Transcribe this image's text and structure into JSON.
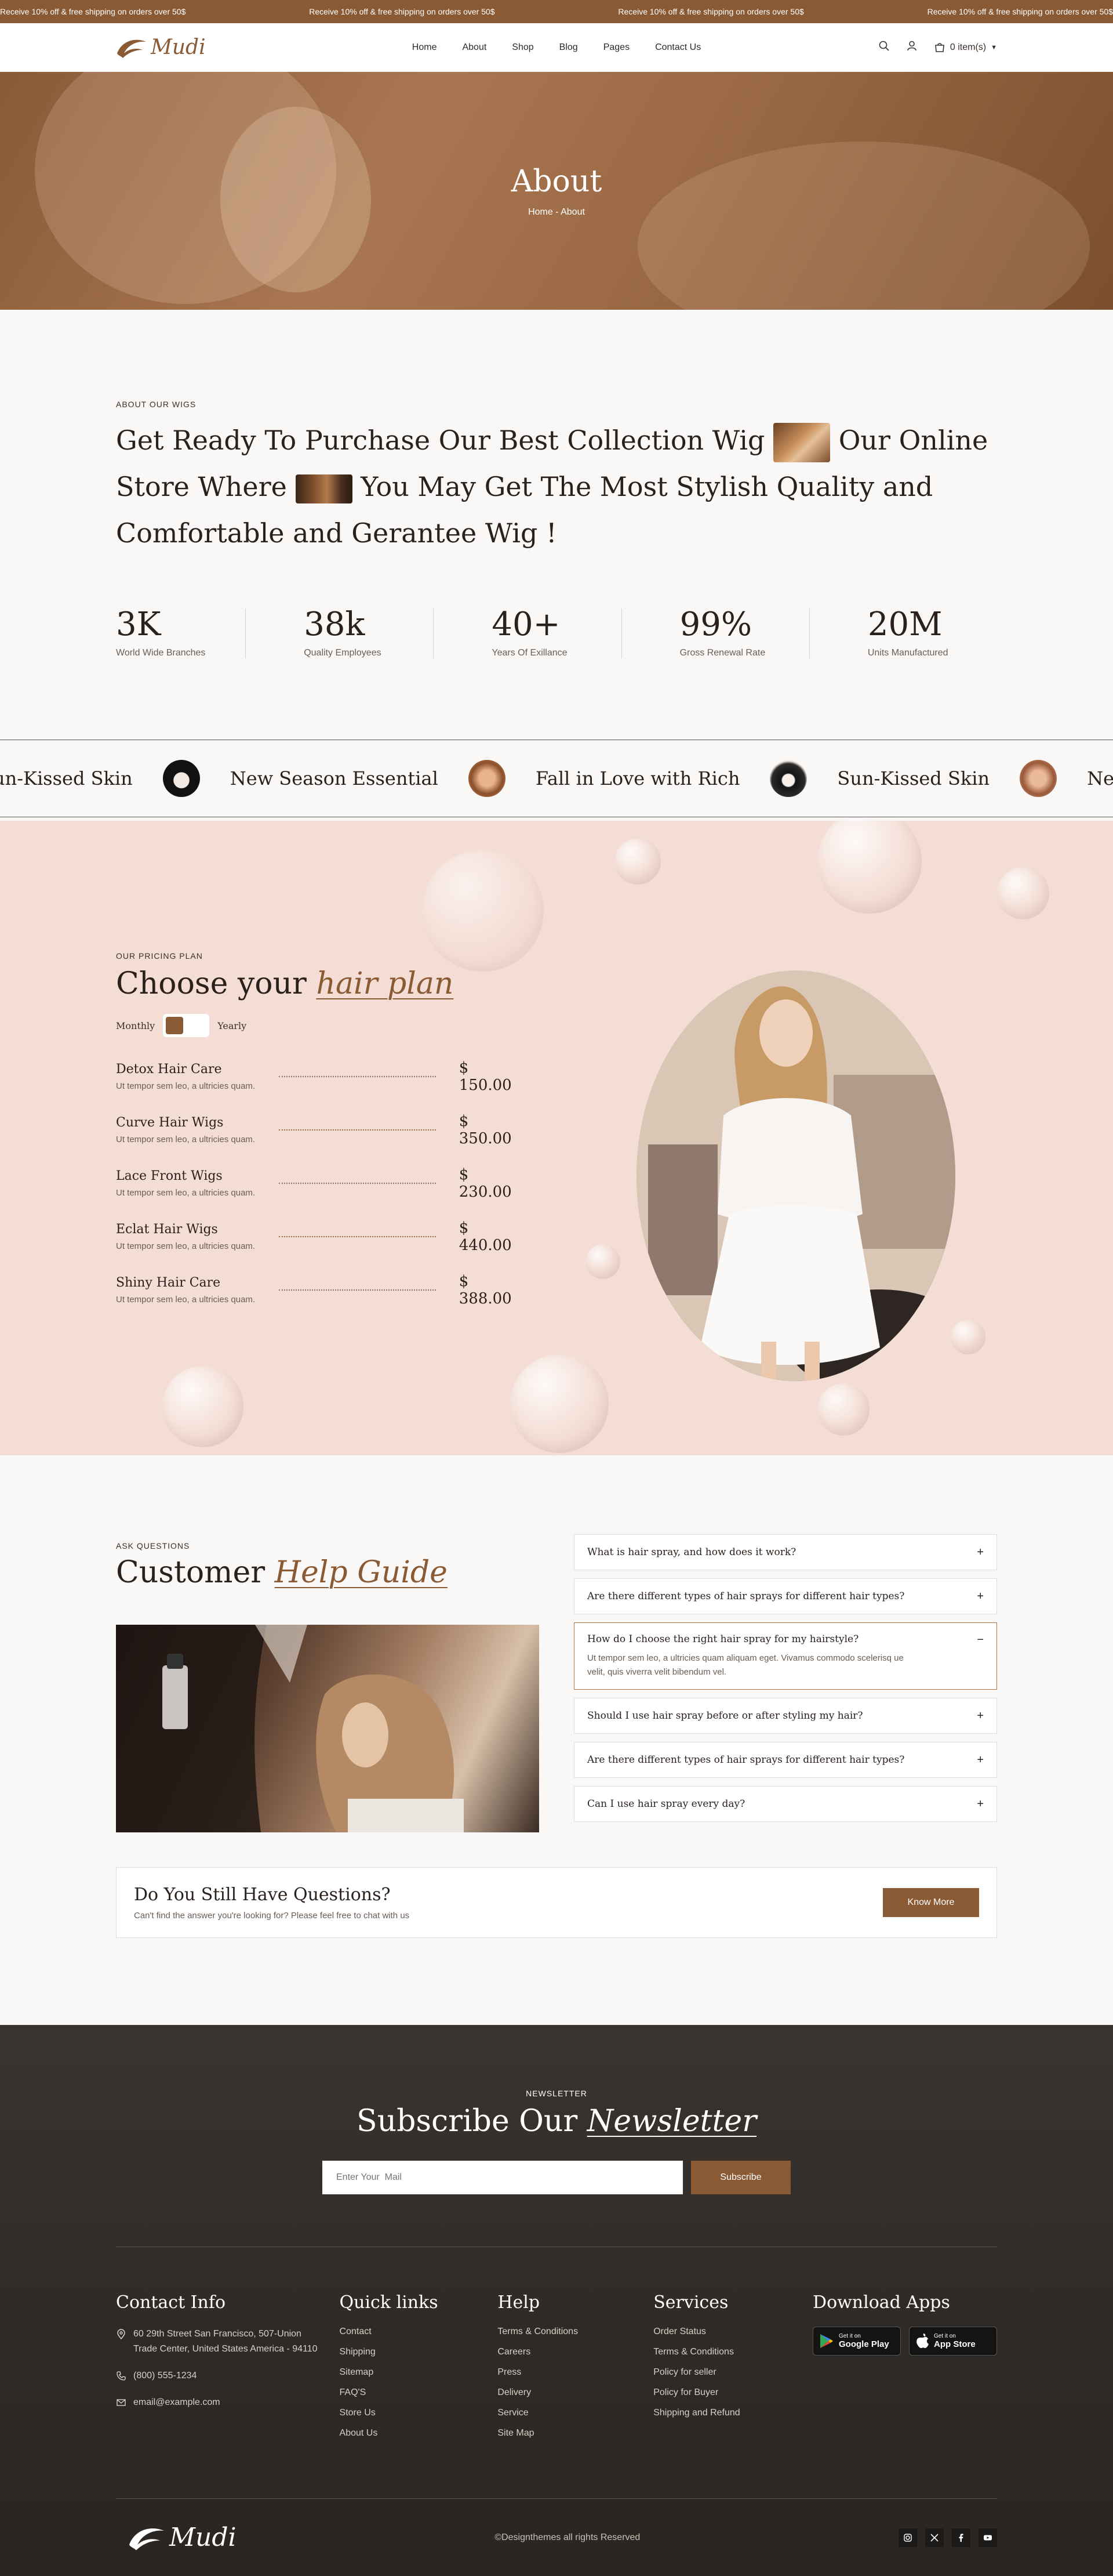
{
  "topbar": {
    "promos": [
      "Receive 10% off & free shipping on orders over 50$",
      "Receive 10% off & free shipping on orders over 50$",
      "Receive 10% off & free shipping on orders over 50$",
      "Receive 10% off & free shipping on orders over 50$"
    ]
  },
  "header": {
    "brand": "Mudi",
    "nav": [
      "Home",
      "About",
      "Shop",
      "Blog",
      "Pages",
      "Contact Us"
    ],
    "cart_label": "0 item(s)",
    "icons": [
      "search-icon",
      "user-icon",
      "cart-icon",
      "caret-down-icon"
    ]
  },
  "hero": {
    "title": "About",
    "breadcrumb": "Home - About"
  },
  "about": {
    "eyebrow": "ABOUT OUR WIGS",
    "heading_part1": "Get Ready To Purchase Our Best Collection Wig",
    "heading_part2": "Our Online Store Where",
    "heading_part3": "You May Get The Most Stylish Quality and Comfortable and Gerantee Wig !",
    "stats": [
      {
        "value": "3K",
        "label": "World Wide Branches"
      },
      {
        "value": "38k",
        "label": "Quality Employees"
      },
      {
        "value": "40+",
        "label": "Years Of Exillance"
      },
      {
        "value": "99%",
        "label": "Gross Renewal Rate"
      },
      {
        "value": "20M",
        "label": "Units Manufactured"
      }
    ]
  },
  "marquee": {
    "items": [
      "un-Kissed Skin",
      "New Season Essential",
      "Fall in Love with Rich",
      "Sun-Kissed Skin",
      "New Seas"
    ]
  },
  "pricing": {
    "eyebrow": "OUR PRICING PLAN",
    "title_plain": "Choose your",
    "title_em": "hair plan",
    "toggle_left": "Monthly",
    "toggle_right": "Yearly",
    "plans": [
      {
        "name": "Detox Hair Care",
        "desc": "Ut tempor sem leo, a ultricies quam.",
        "price": "$ 150.00"
      },
      {
        "name": "Curve Hair Wigs",
        "desc": "Ut tempor sem leo, a ultricies quam.",
        "price": "$ 350.00"
      },
      {
        "name": "Lace Front Wigs",
        "desc": "Ut tempor sem leo, a ultricies quam.",
        "price": "$ 230.00"
      },
      {
        "name": "Eclat Hair Wigs",
        "desc": "Ut tempor sem leo, a ultricies quam.",
        "price": "$ 440.00"
      },
      {
        "name": "Shiny Hair Care",
        "desc": "Ut tempor sem leo, a ultricies quam.",
        "price": "$ 388.00"
      }
    ]
  },
  "faq": {
    "eyebrow": "ASK QUESTIONS",
    "title_plain": "Customer",
    "title_em": "Help Guide",
    "questions": [
      {
        "q": "What is hair spray, and how does it work?",
        "icon": "+"
      },
      {
        "q": "Are there different types of hair sprays for different hair types?",
        "icon": "+"
      },
      {
        "q": "How do I choose the right hair spray for my hairstyle?",
        "icon": "−",
        "answer": "Ut tempor sem leo, a ultricies quam aliquam eget. Vivamus commodo scelerisq ue velit, quis viverra velit bibendum vel."
      },
      {
        "q": "Should I use hair spray before or after styling my hair?",
        "icon": "+"
      },
      {
        "q": "Are there different types of hair sprays for different hair types?",
        "icon": "+"
      },
      {
        "q": "Can I use hair spray every day?",
        "icon": "+"
      }
    ],
    "still_title": "Do You Still Have Questions?",
    "still_desc": "Can't find the answer you're looking for? Please feel free to chat with us",
    "still_button": "Know More"
  },
  "footer": {
    "newsletter_eyebrow": "NEWSLETTER",
    "newsletter_plain": "Subscribe Our",
    "newsletter_em": "Newsletter",
    "email_placeholder": "Enter Your  Mail",
    "subscribe_label": "Subscribe",
    "contact_title": "Contact Info",
    "address": "60 29th Street San Francisco, 507-Union Trade Center, United States America - 94110",
    "phone": "(800) 555-1234",
    "email": "email@example.com",
    "quick_title": "Quick links",
    "quick_links": [
      "Contact",
      "Shipping",
      "Sitemap",
      "FAQ'S",
      "Store Us",
      "About Us"
    ],
    "help_title": "Help",
    "help_links": [
      "Terms & Conditions",
      "Careers",
      "Press",
      "Delivery",
      "Service",
      "Site Map"
    ],
    "services_title": "Services",
    "services_links": [
      "Order Status",
      "Terms & Conditions",
      "Policy for seller",
      "Policy for Buyer",
      "Shipping and Refund"
    ],
    "apps_title": "Download Apps",
    "google_small": "Get it on",
    "google_big": "Google Play",
    "apple_small": "Get it on",
    "apple_big": "App Store",
    "brand": "Mudi",
    "copyright": "©Designthemes all rights Reserved",
    "social": [
      "instagram-icon",
      "x-icon",
      "facebook-icon",
      "youtube-icon"
    ]
  },
  "colors": {
    "accent": "#8a5a35",
    "pricing_bg": "#f4ddd4",
    "footer_bg": "#302b27"
  }
}
